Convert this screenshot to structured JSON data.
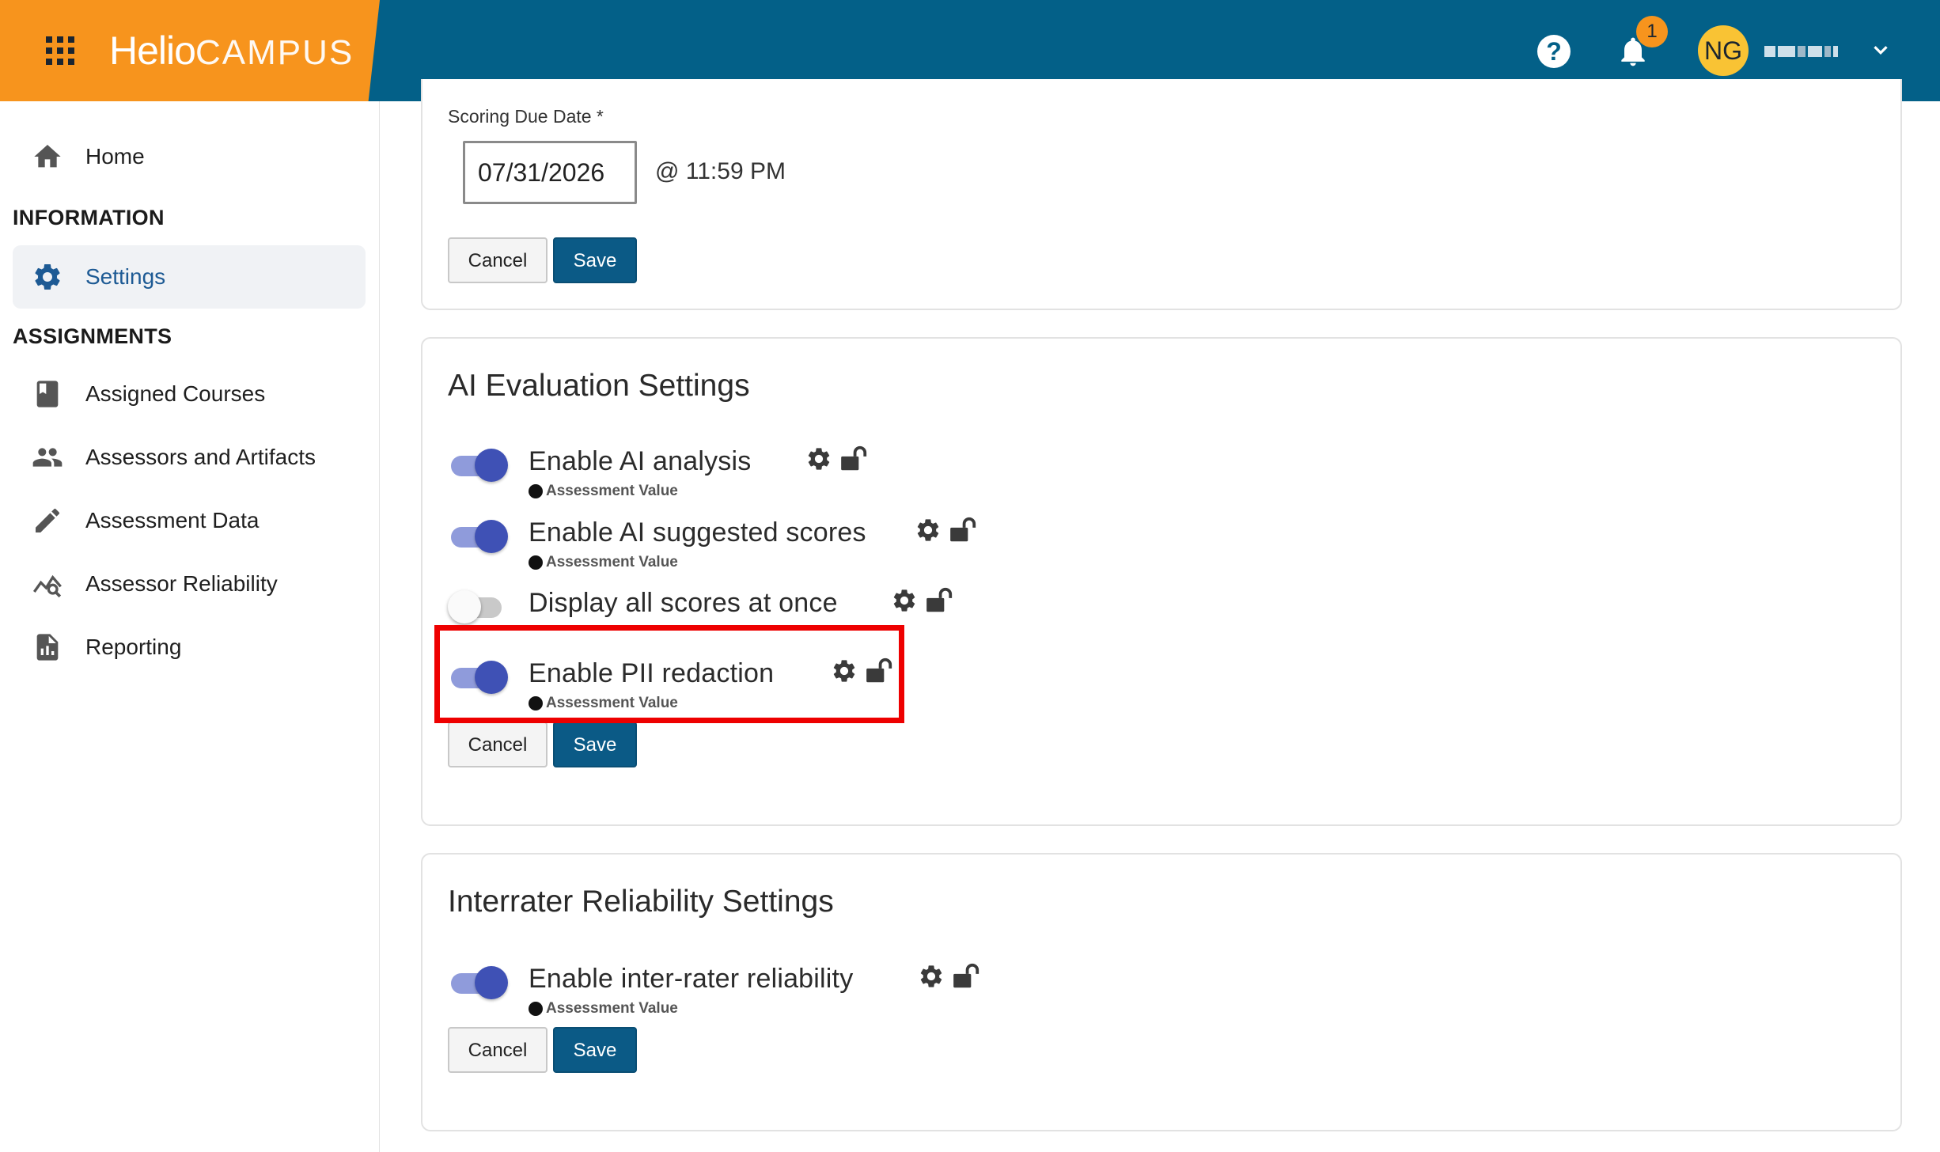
{
  "header": {
    "brand_primary": "Helio",
    "brand_secondary": "CAMPUS",
    "help_icon": "question-circle-icon",
    "help_glyph": "?",
    "notification_count": "1",
    "avatar_initials": "NG",
    "username": "(obscured)",
    "colors": {
      "bar": "#036088",
      "brand": "#f7941d",
      "avatar": "#f9c334"
    }
  },
  "sidebar": {
    "home_label": "Home",
    "section_information": "INFORMATION",
    "settings_label": "Settings",
    "section_assignments": "ASSIGNMENTS",
    "items": [
      {
        "label": "Assigned Courses",
        "icon": "book-icon"
      },
      {
        "label": "Assessors and Artifacts",
        "icon": "people-icon"
      },
      {
        "label": "Assessment Data",
        "icon": "pencil-icon"
      },
      {
        "label": "Assessor Reliability",
        "icon": "chart-search-icon"
      },
      {
        "label": "Reporting",
        "icon": "report-icon"
      }
    ]
  },
  "due_date_card": {
    "label": "Scoring Due Date *",
    "date_value": "07/31/2026",
    "time_text": "@ 11:59 PM",
    "cancel_label": "Cancel",
    "save_label": "Save"
  },
  "ai_card": {
    "title": "AI Evaluation Settings",
    "settings": [
      {
        "name": "Enable AI analysis",
        "sub": "Assessment Value",
        "enabled": true
      },
      {
        "name": "Enable AI suggested scores",
        "sub": "Assessment Value",
        "enabled": true
      },
      {
        "name": "Display all scores at once",
        "sub": "",
        "enabled": false
      },
      {
        "name": "Enable PII redaction",
        "sub": "Assessment Value",
        "enabled": true
      }
    ],
    "cancel_label": "Cancel",
    "save_label": "Save"
  },
  "irr_card": {
    "title": "Interrater Reliability Settings",
    "settings": [
      {
        "name": "Enable inter-rater reliability",
        "sub": "Assessment Value",
        "enabled": true
      }
    ],
    "cancel_label": "Cancel",
    "save_label": "Save"
  },
  "highlight_color": "#ee0000"
}
